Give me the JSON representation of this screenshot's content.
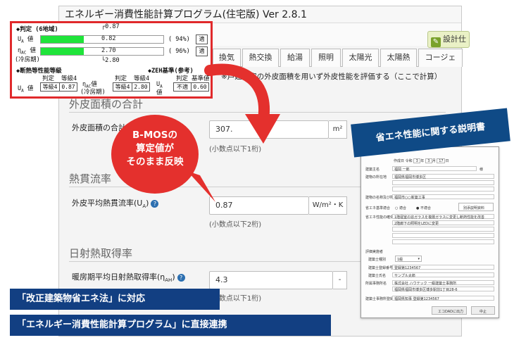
{
  "app": {
    "title": "エネルギー消費性能計算プログラム(住宅版) Ver 2.8.1",
    "settings_label": "設計仕",
    "tabs": [
      "換気",
      "熱交換",
      "給湯",
      "照明",
      "太陽光",
      "太陽熱",
      "コージェ"
    ],
    "description": "※戸建住宅の外皮面積を用いず外皮性能を評価する（ここで計算）",
    "sections": {
      "area": {
        "title": "外皮面積の合計",
        "field_label": "外皮面積の合計",
        "value": "307.",
        "unit": "m²",
        "hint": "(小数点以下1桁)"
      },
      "insulation": {
        "title": "熱貫流率",
        "field_label": "外皮平均熱貫流率(U",
        "field_label_sub": "A",
        "field_label_end": ")",
        "value": "0.87",
        "unit": "W/m²・K",
        "hint": "(小数点以下2桁)"
      },
      "solar": {
        "title": "日射熱取得率",
        "field_label": "暖房期平均日射熱取得率(η",
        "field_label_sub": "AH",
        "field_label_end": ")",
        "value": "4.3",
        "stepper": "-",
        "hint": "(小数点以下1桁)"
      }
    }
  },
  "bmos": {
    "judgement_title": "◆判定 (6地域)",
    "ua_marker": "0.87",
    "ua_label": "U",
    "ua_sub": "A",
    "ua_suffix": "値",
    "ua_value": "0.82",
    "ua_fill": 0.35,
    "ua_percent": "( 94%)",
    "ua_result": "適",
    "eta_label": "η",
    "eta_sub": "AC",
    "eta_suffix": "値",
    "eta_season": "(冷房期)",
    "eta_value": "2.70",
    "eta_fill": 0.35,
    "eta_percent": "( 96%)",
    "eta_result": "適",
    "eta_marker": "2.80",
    "grade_title": "◆断熱等性能等級",
    "zeh_title": "◆ZEH基準(参考)",
    "judge_header": "判定",
    "grade_header": "等級4",
    "ua_grade": "等級4",
    "ua_grade_val": "0.87",
    "eta_grade": "等級4",
    "eta_grade_val": "2.80",
    "zeh_judge_header": "判定",
    "zeh_std_header": "基準値",
    "zeh_label": "U",
    "zeh_label_sub": "A",
    "zeh_suffix": "値",
    "zeh_result": "不適",
    "zeh_value": "0.60"
  },
  "callout": {
    "line1": "B-MOSの",
    "line2": "算定値が",
    "line3": "そのまま反映"
  },
  "doc": {
    "label": "省エネ性能に関する説明書",
    "date_prefix": "作成日",
    "era": "令和",
    "year": "3",
    "year_unit": "年",
    "month": "3",
    "month_unit": "月",
    "day": "17",
    "day_unit": "日",
    "owner_label": "建築主名",
    "owner_value": "福岡 一郎",
    "owner_suffix": "様",
    "location_label": "建物の所在地",
    "location_value": "福岡県福岡市博多区",
    "name_label": "建物の名称及び所在",
    "name_value": "福岡市○○新築工事",
    "criteria_label": "省エネ基準適合",
    "criteria_fit": "適合",
    "criteria_unfit": "不適合",
    "criteria_note": "別添説明資料",
    "measures_label": "省エネ性能の確保のための措置",
    "measures_line1": "1階寝室の窓ガラスを複層ガラスに変更し断熱性能を改善",
    "measures_line2": "2階廊下の照明をLEDに変更",
    "designer_heading": "評価実施者",
    "qual_label": "建築士種別",
    "qual_value": "1級",
    "reg_label": "建築士登録番号",
    "reg_value": "登録第1234567",
    "arch_label": "建築士氏名",
    "arch_value": "サンプル太郎",
    "office_label": "所属事務所名",
    "office_value": "株式会社 ハウテック 一級建築士事務所",
    "office_addr": "福岡県福岡市博多区博多駅前1丁目28-6",
    "office_reg_label": "建築士事務所登録番号",
    "office_reg_value": "福岡県知事 登録第1234567",
    "export_button": "エコDADに出力",
    "close_button": "中止"
  },
  "banners": {
    "law": "「改正建築物省エネ法」に対応",
    "program": "「エネルギー消費性能計算プログラム」に直接連携"
  },
  "colors": {
    "accent_red": "#e4302d",
    "navy": "#123f82",
    "gauge_green": "#1fe43a"
  }
}
